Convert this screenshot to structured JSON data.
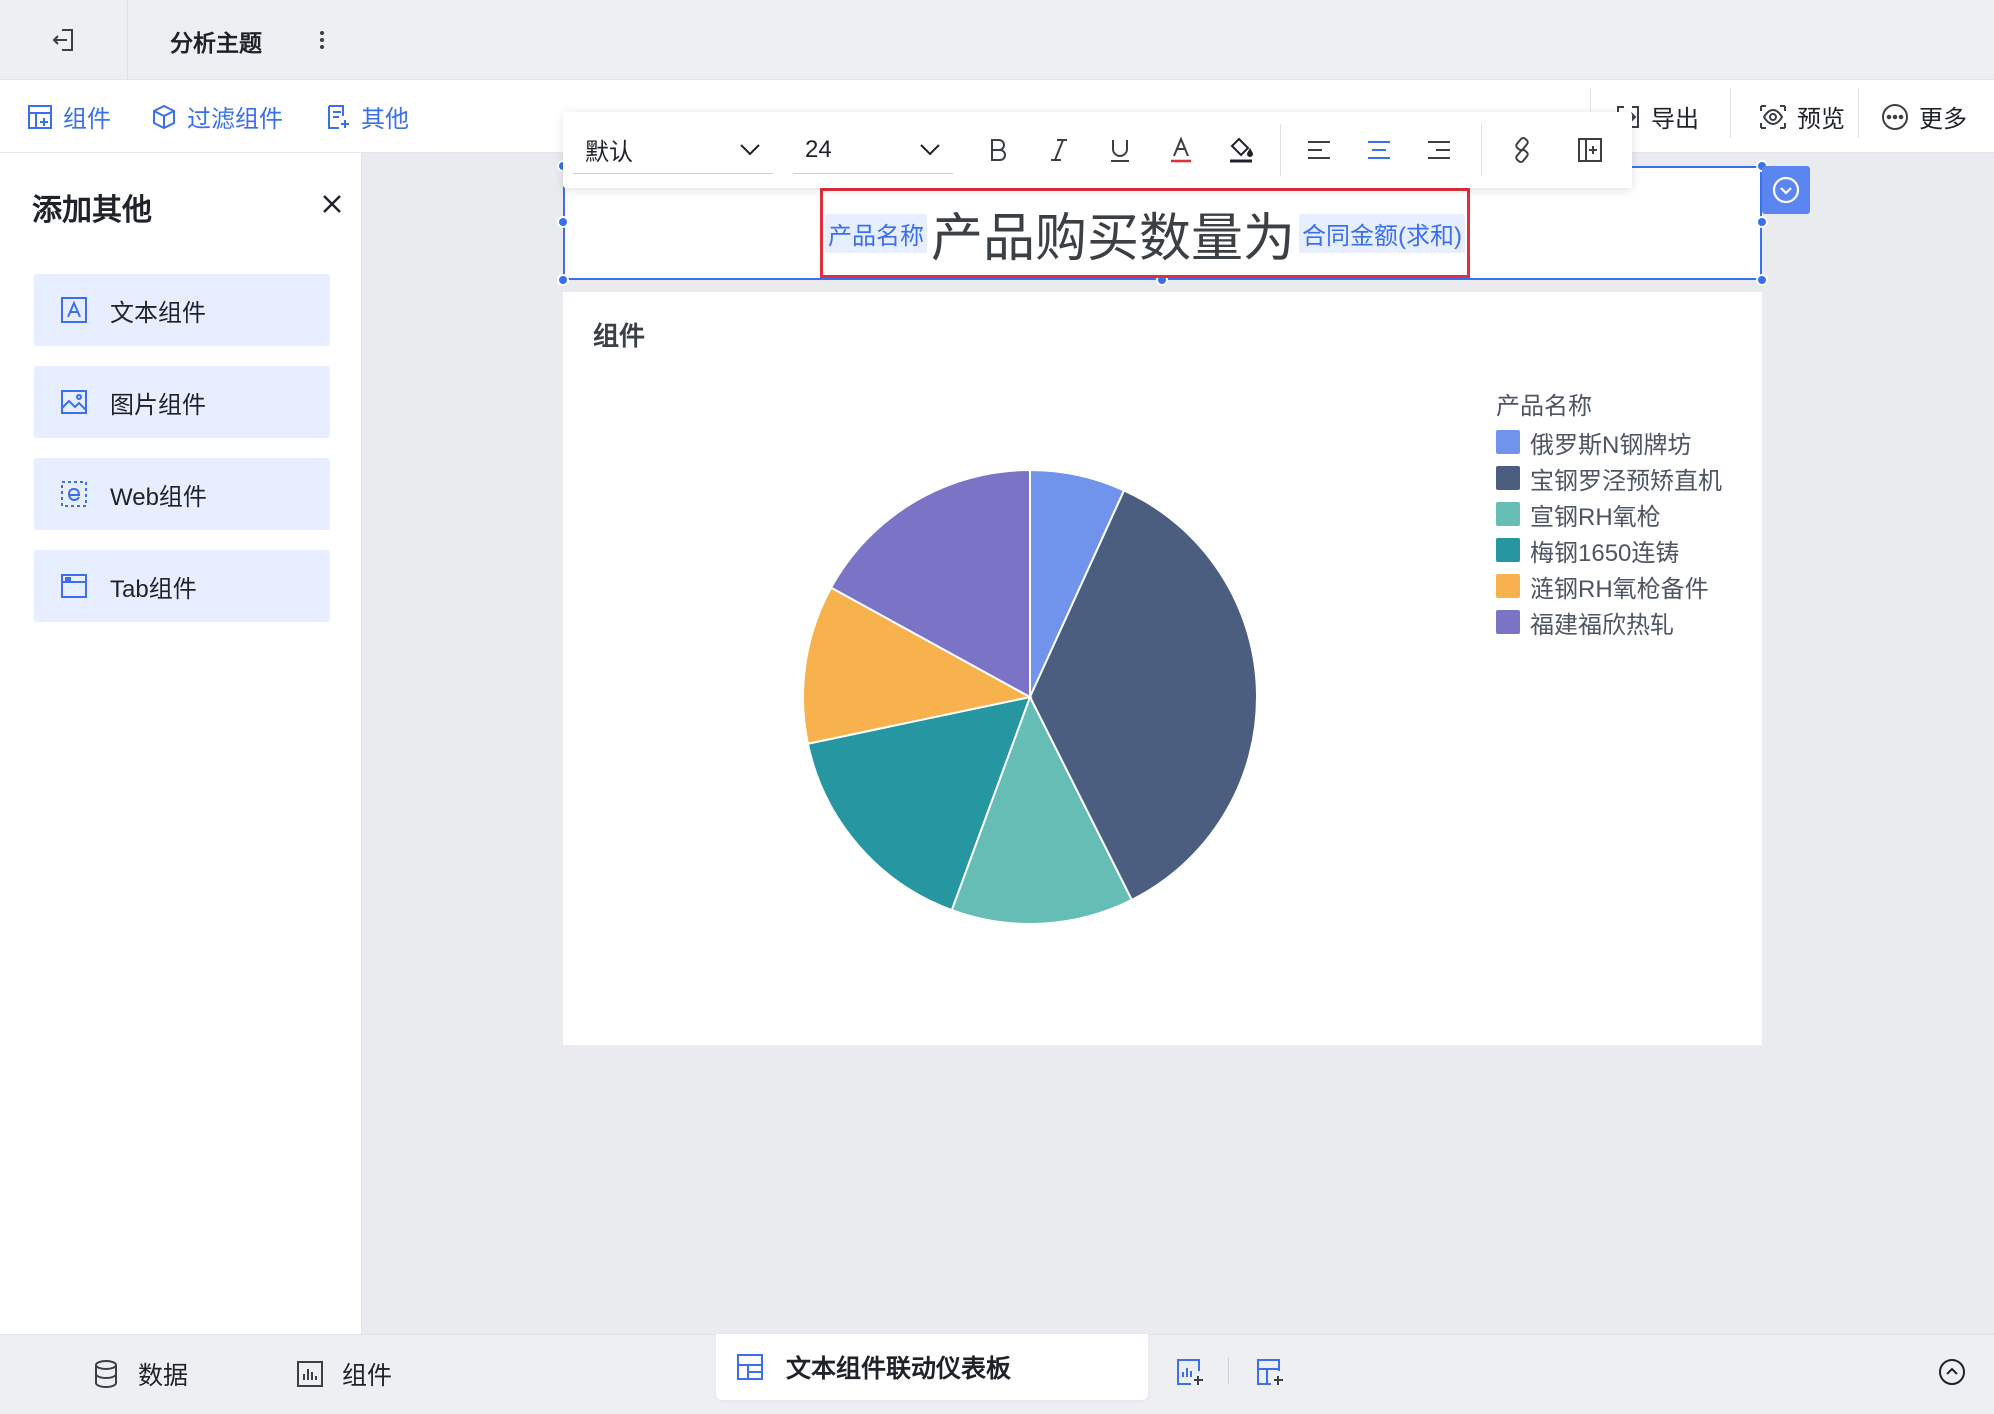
{
  "header": {
    "title": "分析主题"
  },
  "toolbar": {
    "left": [
      "组件",
      "过滤组件",
      "其他"
    ],
    "right": {
      "export": "导出",
      "preview": "预览",
      "more": "更多"
    }
  },
  "left_panel": {
    "title": "添加其他",
    "items": [
      "文本组件",
      "图片组件",
      "Web组件",
      "Tab组件"
    ]
  },
  "format_bar": {
    "font": "默认",
    "size": "24"
  },
  "text_component": {
    "field_before": "产品名称",
    "text": "产品购买数量为",
    "field_after": "合同金额(求和)"
  },
  "chart_card": {
    "title": "组件"
  },
  "chart_data": {
    "type": "pie",
    "legend_title": "产品名称",
    "legend_position": "top-right",
    "categories": [
      "俄罗斯N钢牌坊",
      "宝钢罗泾预矫直机",
      "宣钢RH氧枪",
      "梅钢1650连铸",
      "涟钢RH氧枪备件",
      "福建福欣热轧"
    ],
    "values": [
      6.8,
      35.8,
      13.0,
      16.1,
      11.3,
      17.0
    ],
    "colors": [
      "#7093ec",
      "#4c5e80",
      "#66bdb5",
      "#2696a0",
      "#f7b24e",
      "#7b73c6"
    ]
  },
  "bottom_bar": {
    "data": "数据",
    "component": "组件",
    "active_tab": "文本组件联动仪表板"
  }
}
